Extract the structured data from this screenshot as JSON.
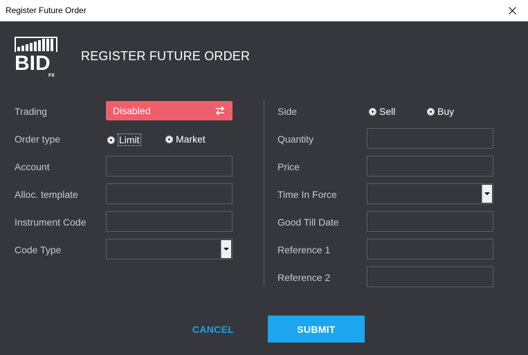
{
  "window": {
    "title": "Register Future Order"
  },
  "header": {
    "logo_text": "BID",
    "logo_sub": "FX",
    "title": "REGISTER FUTURE ORDER"
  },
  "left": {
    "trading": {
      "label": "Trading",
      "value": "Disabled"
    },
    "order_type": {
      "label": "Order type",
      "options": [
        "Limit",
        "Market"
      ]
    },
    "account": {
      "label": "Account",
      "value": ""
    },
    "alloc_template": {
      "label": "Alloc. template",
      "value": ""
    },
    "instrument_code": {
      "label": "Instrument Code",
      "value": ""
    },
    "code_type": {
      "label": "Code Type",
      "value": ""
    }
  },
  "right": {
    "side": {
      "label": "Side",
      "options": [
        "Sell",
        "Buy"
      ]
    },
    "quantity": {
      "label": "Quantity",
      "value": ""
    },
    "price": {
      "label": "Price",
      "value": ""
    },
    "time_in_force": {
      "label": "Time In Force",
      "value": ""
    },
    "good_till_date": {
      "label": "Good Till Date",
      "value": ""
    },
    "reference1": {
      "label": "Reference 1",
      "value": ""
    },
    "reference2": {
      "label": "Reference 2",
      "value": ""
    }
  },
  "actions": {
    "cancel": "CANCEL",
    "submit": "SUBMIT"
  },
  "colors": {
    "background": "#35373d",
    "disabled_toggle": "#ef5f6b",
    "accent": "#1ba6ef"
  },
  "icons": {
    "close": "close-icon",
    "swap": "swap-arrows-icon",
    "dropdown": "chevron-down-icon"
  }
}
